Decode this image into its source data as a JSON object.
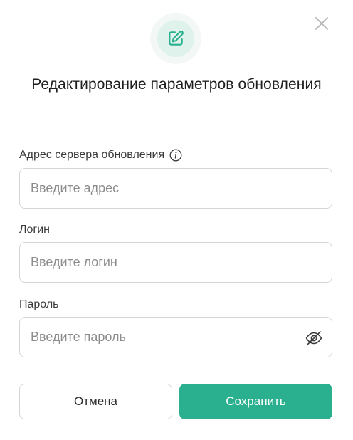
{
  "dialog": {
    "title": "Редактирование параметров обновления",
    "accent_color": "#2bb08f"
  },
  "icons": {
    "header": "edit-icon",
    "close": "close-icon",
    "info": "info-icon",
    "password_visibility": "eye-off-icon"
  },
  "fields": {
    "server": {
      "label": "Адрес сервера обновления",
      "value": "",
      "placeholder": "Введите адрес"
    },
    "login": {
      "label": "Логин",
      "value": "",
      "placeholder": "Введите логин"
    },
    "password": {
      "label": "Пароль",
      "value": "",
      "placeholder": "Введите пароль"
    }
  },
  "buttons": {
    "cancel_label": "Отмена",
    "save_label": "Сохранить"
  }
}
